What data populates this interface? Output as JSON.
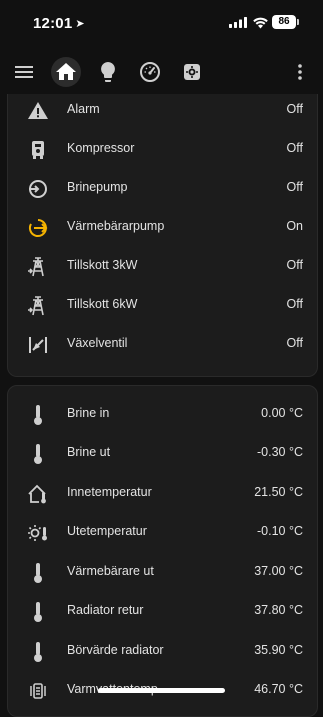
{
  "status": {
    "time": "12:01",
    "battery": "86"
  },
  "colors": {
    "background": "#111111",
    "card": "#1c1c1c",
    "icon": "#cfcfcf",
    "active_icon": "#f5b301",
    "text": "#e3e3e3"
  },
  "toolbar": {
    "icons": [
      "menu-icon",
      "home-icon",
      "lightbulb-icon",
      "gauge-icon",
      "settings-icon",
      "more-vert-icon"
    ]
  },
  "binary_sensors": [
    {
      "label": "Alarm",
      "value": "Off",
      "icon": "alert-icon"
    },
    {
      "label": "Kompressor",
      "value": "Off",
      "icon": "compressor-icon"
    },
    {
      "label": "Brinepump",
      "value": "Off",
      "icon": "pump-icon"
    },
    {
      "label": "Värmebärarpump",
      "value": "On",
      "icon": "pump-active-icon"
    },
    {
      "label": "Tillskott 3kW",
      "value": "Off",
      "icon": "transmission-tower-icon"
    },
    {
      "label": "Tillskott 6kW",
      "value": "Off",
      "icon": "transmission-tower-icon"
    },
    {
      "label": "Växelventil",
      "value": "Off",
      "icon": "valve-icon"
    }
  ],
  "sensors": [
    {
      "label": "Brine in",
      "value": "0.00 °C",
      "icon": "thermometer-icon"
    },
    {
      "label": "Brine ut",
      "value": "-0.30 °C",
      "icon": "thermometer-icon"
    },
    {
      "label": "Innetemperatur",
      "value": "21.50 °C",
      "icon": "home-thermometer-icon"
    },
    {
      "label": "Utetemperatur",
      "value": "-0.10 °C",
      "icon": "sun-thermometer-icon"
    },
    {
      "label": "Värmebärare ut",
      "value": "37.00 °C",
      "icon": "thermometer-icon"
    },
    {
      "label": "Radiator retur",
      "value": "37.80 °C",
      "icon": "thermometer-icon"
    },
    {
      "label": "Börvärde radiator",
      "value": "35.90 °C",
      "icon": "thermometer-icon"
    },
    {
      "label": "Varmvattentemp",
      "value": "46.70 °C",
      "icon": "water-boiler-icon"
    }
  ]
}
